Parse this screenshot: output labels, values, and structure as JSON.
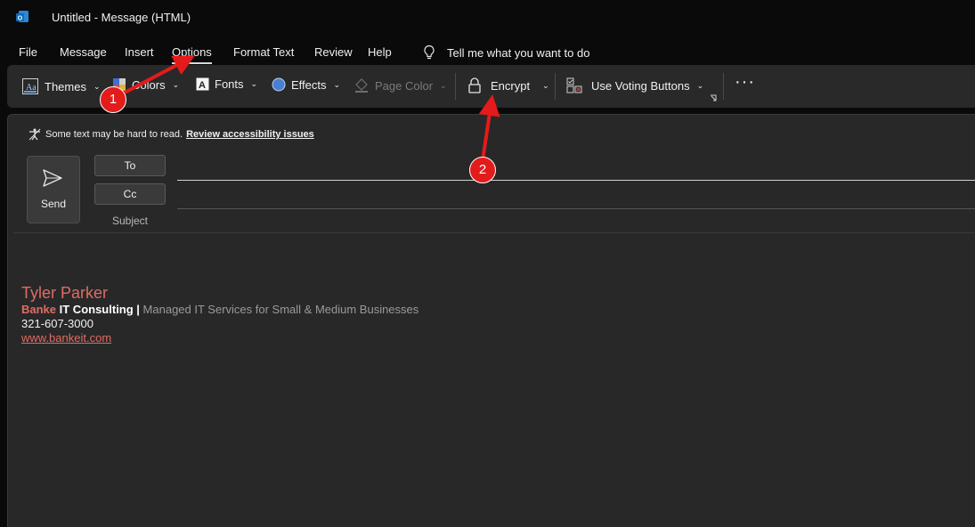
{
  "window": {
    "title": "Untitled  -  Message (HTML)"
  },
  "menu": {
    "file": "File",
    "message": "Message",
    "insert": "Insert",
    "options": "Options",
    "format_text": "Format Text",
    "review": "Review",
    "help": "Help",
    "tell_me": "Tell me what you want to do"
  },
  "ribbon": {
    "themes": "Themes",
    "colors": "Colors",
    "fonts": "Fonts",
    "effects": "Effects",
    "page_color": "Page Color",
    "encrypt": "Encrypt",
    "voting": "Use Voting Buttons"
  },
  "compose": {
    "accessibility_text": "Some text may be hard to read.",
    "accessibility_link": "Review accessibility issues",
    "send": "Send",
    "to": "To",
    "cc": "Cc",
    "subject": "Subject"
  },
  "signature": {
    "name": "Tyler Parker",
    "company_a": "Banke",
    "company_b": " IT Consulting |",
    "tagline": " Managed IT Services for Small & Medium Businesses",
    "phone": "321-607-3000",
    "website": "www.bankeit.com"
  },
  "annotations": {
    "badge1": "1",
    "badge2": "2"
  },
  "colors": {
    "accent_red": "#e31b1b",
    "signature_red": "#e06c63",
    "outlook_blue": "#0f6cbd"
  }
}
